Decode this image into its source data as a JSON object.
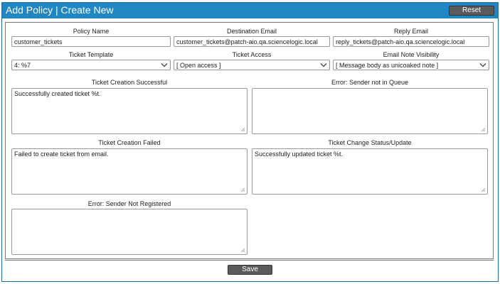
{
  "header": {
    "title": "Add Policy | Create New",
    "reset_label": "Reset"
  },
  "form": {
    "policy_name": {
      "label": "Policy Name",
      "value": "customer_tickets"
    },
    "destination_email": {
      "label": "Destination Email",
      "value": "customer_tickets@patch-aio.qa.sciencelogic.local"
    },
    "reply_email": {
      "label": "Reply Email",
      "value": "reply_tickets@patch-aio.qa.sciencelogic.local"
    },
    "ticket_template": {
      "label": "Ticket Template",
      "value": "4: %7"
    },
    "ticket_access": {
      "label": "Ticket Access",
      "value": "[ Open access ]"
    },
    "email_note_visibility": {
      "label": "Email Note Visibility",
      "value": "[ Message body as unicoaked note ]"
    },
    "ticket_creation_successful": {
      "label": "Ticket Creation Successful",
      "value": "Successfully created ticket %t."
    },
    "error_sender_not_in_queue": {
      "label": "Error: Sender not in Queue",
      "value": ""
    },
    "ticket_creation_failed": {
      "label": "Ticket Creation Failed",
      "value": "Failed to create ticket from email."
    },
    "ticket_change_status_update": {
      "label": "Ticket Change Status/Update",
      "value": "Successfully updated ticket %t."
    },
    "error_sender_not_registered": {
      "label": "Error: Sender Not Registered",
      "value": ""
    }
  },
  "footer": {
    "save_label": "Save"
  }
}
